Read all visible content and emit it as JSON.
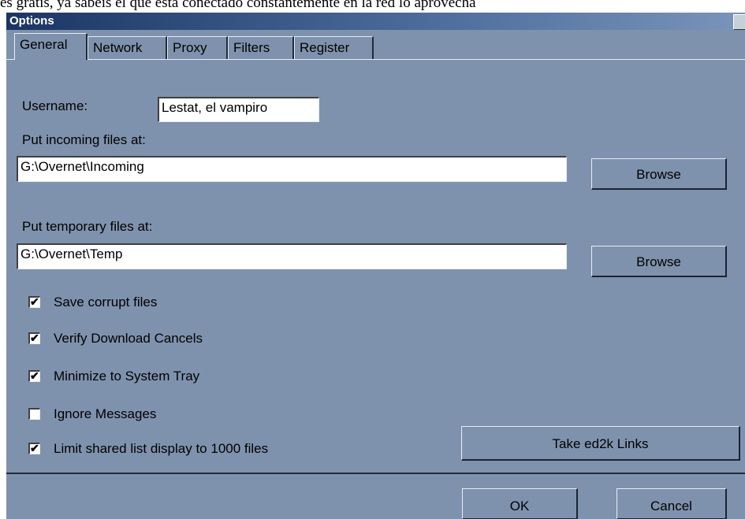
{
  "top_strip": {
    "text": "es gratis, ya sabéis el que está conectado constantemente en la red lo aprovecha"
  },
  "window": {
    "title": "Options"
  },
  "tabs": [
    {
      "label": "General",
      "active": true
    },
    {
      "label": "Network",
      "active": false
    },
    {
      "label": "Proxy",
      "active": false
    },
    {
      "label": "Filters",
      "active": false
    },
    {
      "label": "Register",
      "active": false
    }
  ],
  "general": {
    "username_label": "Username:",
    "username_value": "Lestat, el vampiro",
    "incoming_label": "Put incoming files at:",
    "incoming_value": "G:\\Overnet\\Incoming",
    "temp_label": "Put temporary files at:",
    "temp_value": "G:\\Overnet\\Temp",
    "browse_label": "Browse",
    "checkboxes": [
      {
        "label": "Save corrupt files",
        "checked": true
      },
      {
        "label": "Verify Download Cancels",
        "checked": true
      },
      {
        "label": "Minimize to System Tray",
        "checked": true
      },
      {
        "label": "Ignore Messages",
        "checked": false
      },
      {
        "label": "Limit shared list display to 1000 files",
        "checked": true
      }
    ],
    "ed2k_button": "Take ed2k Links"
  },
  "footer": {
    "ok_label": "OK",
    "cancel_label": "Cancel"
  },
  "colors": {
    "dialog_bg": "#7f92ad",
    "titlebar": "#1b3563"
  }
}
